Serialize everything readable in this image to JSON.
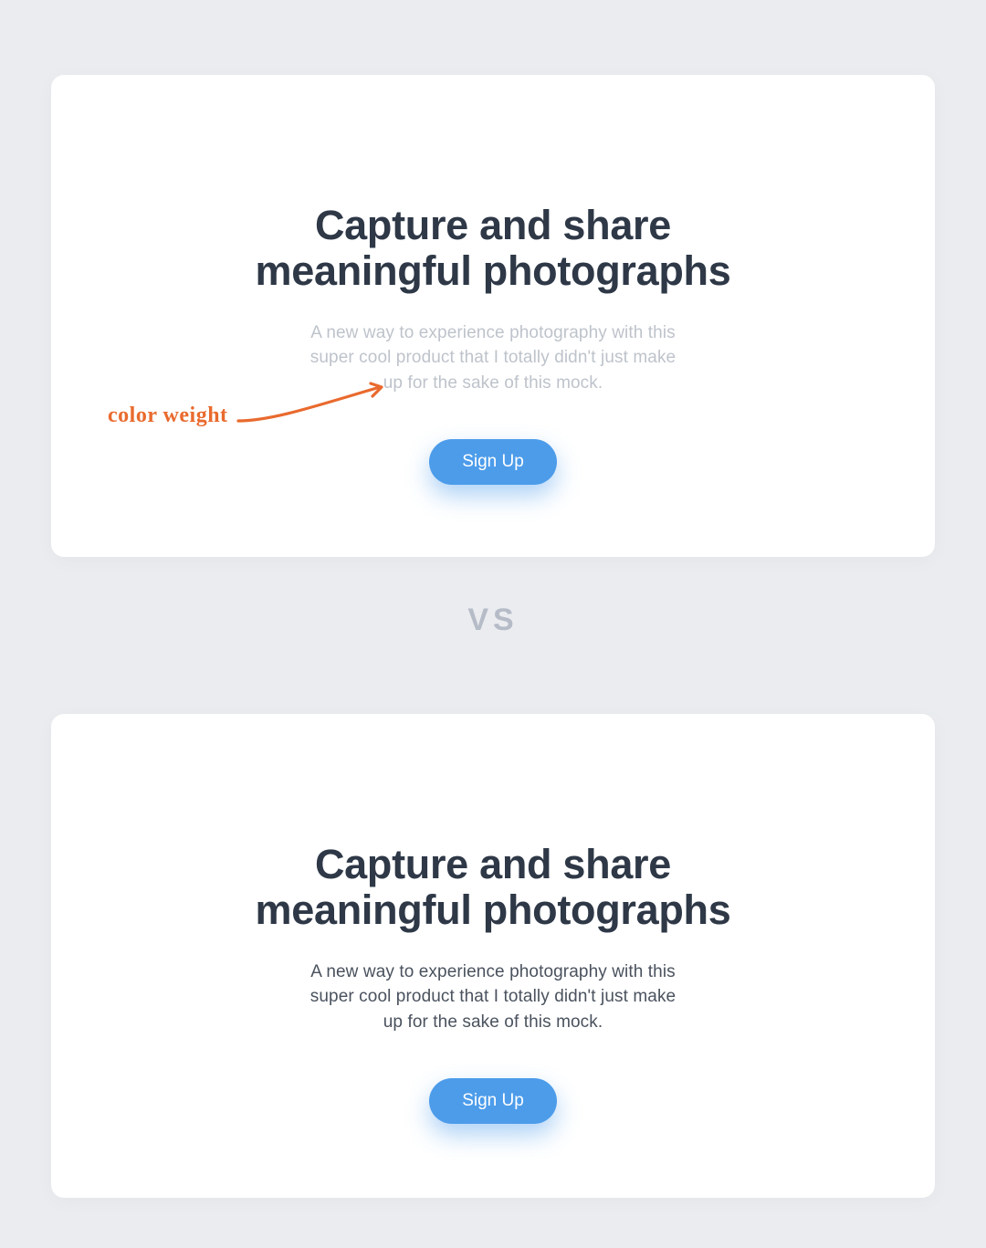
{
  "annotation": {
    "label": "color weight"
  },
  "vs_label": "VS",
  "card1": {
    "headline_line1": "Capture and share",
    "headline_line2": "meaningful photographs",
    "subtext": "A new way to experience photography with this super cool product that I totally didn't just make up for the sake of this mock.",
    "cta_label": "Sign Up"
  },
  "card2": {
    "headline_line1": "Capture and share",
    "headline_line2": "meaningful photographs",
    "subtext": "A new way to experience photography with this super cool product that I totally didn't just make up for the sake of this mock.",
    "cta_label": "Sign Up"
  },
  "colors": {
    "background": "#ebecf0",
    "card_bg": "#ffffff",
    "headline": "#2e3847",
    "subtext_light": "#bec3cb",
    "subtext_dark": "#4a525e",
    "button": "#4c9cea",
    "annotation": "#e96a2e",
    "vs": "#b6bcc7"
  }
}
